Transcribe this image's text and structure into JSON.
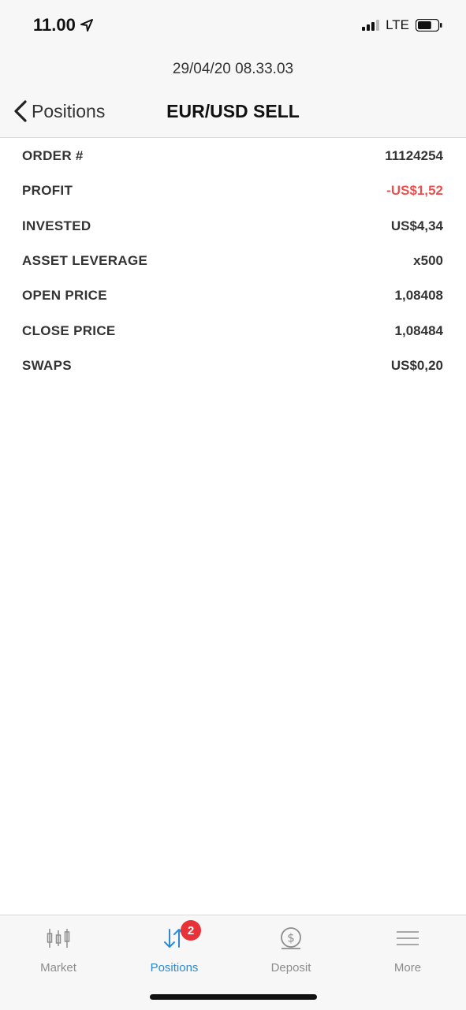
{
  "status_bar": {
    "time": "11.00",
    "network": "LTE",
    "battery_level": 0.7
  },
  "header": {
    "timestamp": "29/04/20 08.33.03",
    "back_label": "Positions",
    "title": "EUR/USD SELL"
  },
  "details": [
    {
      "label": "ORDER #",
      "value": "11124254"
    },
    {
      "label": "PROFIT",
      "value": "-US$1,52",
      "color": "#e8514f"
    },
    {
      "label": "INVESTED",
      "value": "US$4,34"
    },
    {
      "label": "ASSET LEVERAGE",
      "value": "x500"
    },
    {
      "label": "OPEN PRICE",
      "value": "1,08408"
    },
    {
      "label": "CLOSE PRICE",
      "value": "1,08484"
    },
    {
      "label": "SWAPS",
      "value": "US$0,20"
    }
  ],
  "tabbar": {
    "tabs": [
      {
        "label": "Market",
        "icon": "candlestick-icon"
      },
      {
        "label": "Positions",
        "icon": "up-down-arrows-icon",
        "active": true,
        "badge": "2"
      },
      {
        "label": "Deposit",
        "icon": "dollar-coin-icon"
      },
      {
        "label": "More",
        "icon": "menu-lines-icon"
      }
    ]
  },
  "colors": {
    "accent": "#2a8ad9",
    "negative": "#e8514f",
    "badge": "#e8323a"
  }
}
